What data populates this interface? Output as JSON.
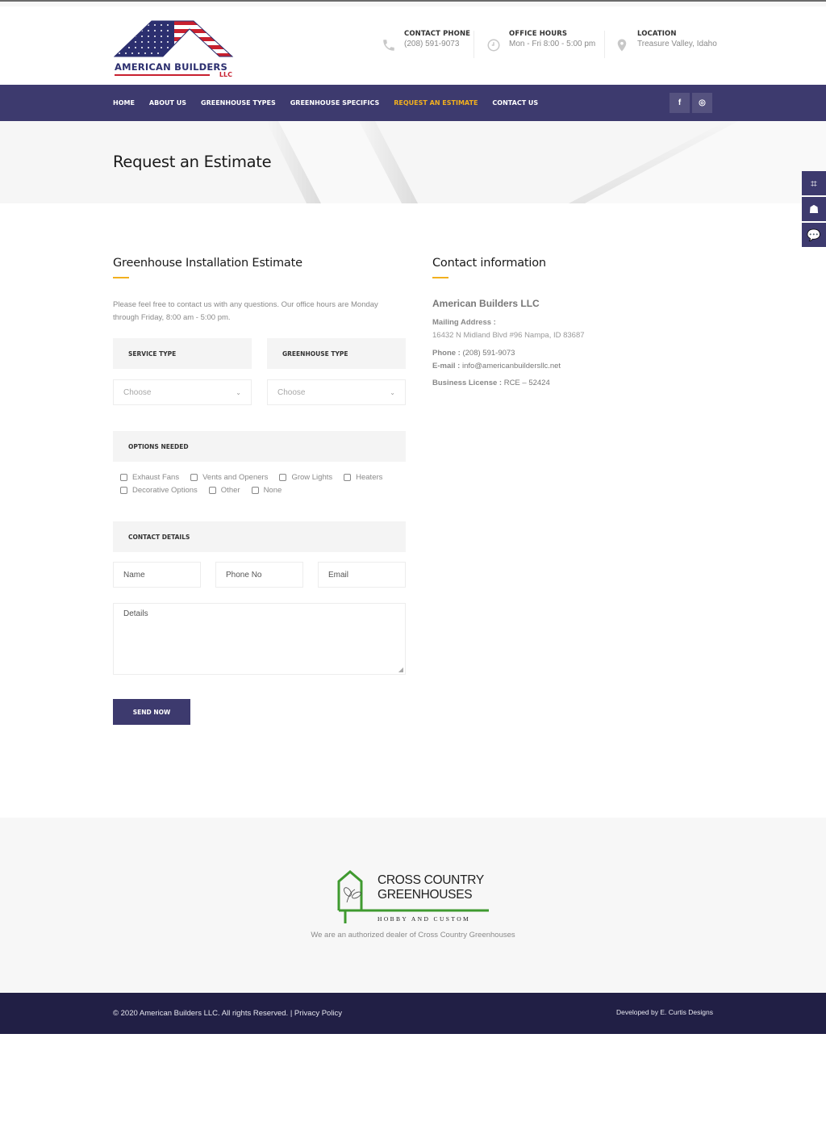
{
  "header": {
    "logo": {
      "brand": "AMERICAN BUILDERS",
      "suffix": "LLC"
    },
    "info": [
      {
        "icon": "phone-icon",
        "label": "CONTACT PHONE",
        "value": "(208) 591-9073"
      },
      {
        "icon": "clock-icon",
        "label": "OFFICE HOURS",
        "value": "Mon - Fri 8:00 - 5:00 pm"
      },
      {
        "icon": "map-pin-icon",
        "label": "LOCATION",
        "value": "Treasure Valley, Idaho"
      }
    ]
  },
  "nav": {
    "items": [
      {
        "label": "HOME",
        "active": false
      },
      {
        "label": "ABOUT US",
        "active": false
      },
      {
        "label": "GREENHOUSE TYPES",
        "active": false
      },
      {
        "label": "GREENHOUSE SPECIFICS",
        "active": false
      },
      {
        "label": "REQUEST AN ESTIMATE",
        "active": true
      },
      {
        "label": "CONTACT US",
        "active": false
      }
    ],
    "social": [
      {
        "icon": "facebook-icon",
        "glyph": "f"
      },
      {
        "icon": "instagram-icon",
        "glyph": "◎"
      }
    ],
    "active_color": "#f2b01e"
  },
  "banner": {
    "title": "Request an Estimate"
  },
  "side_tabs": [
    {
      "icon": "crop-icon",
      "glyph": "⌗"
    },
    {
      "icon": "book-reader-icon",
      "glyph": "☗"
    },
    {
      "icon": "chat-bubble-icon",
      "glyph": "💬"
    }
  ],
  "form": {
    "title": "Greenhouse Installation Estimate",
    "intro": "Please feel free to contact us with any questions. Our office hours are Monday through Friday, 8:00 am - 5:00 pm.",
    "service_type": {
      "label": "SERVICE TYPE",
      "selected": "Choose"
    },
    "greenhouse_type": {
      "label": "GREENHOUSE TYPE",
      "selected": "Choose"
    },
    "options": {
      "label": "OPTIONS NEEDED",
      "items": [
        {
          "label": "Exhaust Fans",
          "checked": false
        },
        {
          "label": "Vents and Openers",
          "checked": false
        },
        {
          "label": "Grow Lights",
          "checked": false
        },
        {
          "label": "Heaters",
          "checked": false
        },
        {
          "label": "Decorative Options",
          "checked": false
        },
        {
          "label": "Other",
          "checked": false
        },
        {
          "label": "None",
          "checked": false
        }
      ]
    },
    "contact": {
      "label": "CONTACT DETAILS",
      "name_placeholder": "Name",
      "phone_placeholder": "Phone No",
      "email_placeholder": "Email",
      "details_placeholder": "Details"
    },
    "submit_label": "SEND NOW"
  },
  "contact_info": {
    "title": "Contact information",
    "company": "American Builders LLC",
    "mailing_label": "Mailing Address :",
    "mailing_value": "16432 N Midland Blvd #96 Nampa, ID 83687",
    "phone_label": "Phone :",
    "phone_value": "(208) 591-9073",
    "email_label": "E-mail :",
    "email_value": "info@americanbuildersllc.net",
    "license_label": "Business License :",
    "license_value": "RCE – 52424"
  },
  "partner": {
    "line1": "CROSS COUNTRY",
    "line2": "GREENHOUSES",
    "line3": "HOBBY AND CUSTOM",
    "dealer_text": "We are an authorized dealer of Cross Country Greenhouses"
  },
  "footer": {
    "copyright": "© 2020 American Builders LLC. All rights Reserved.",
    "separator": "|",
    "privacy_link": "Privacy Policy",
    "developer": "Developed by E. Curtis Designs"
  },
  "colors": {
    "primary": "#3d3a6e",
    "accent": "#f2b01e",
    "footer_dark": "#211f45",
    "flag_red": "#c8202f",
    "flag_blue": "#2c2f6f",
    "partner_green": "#3f9a2f"
  }
}
